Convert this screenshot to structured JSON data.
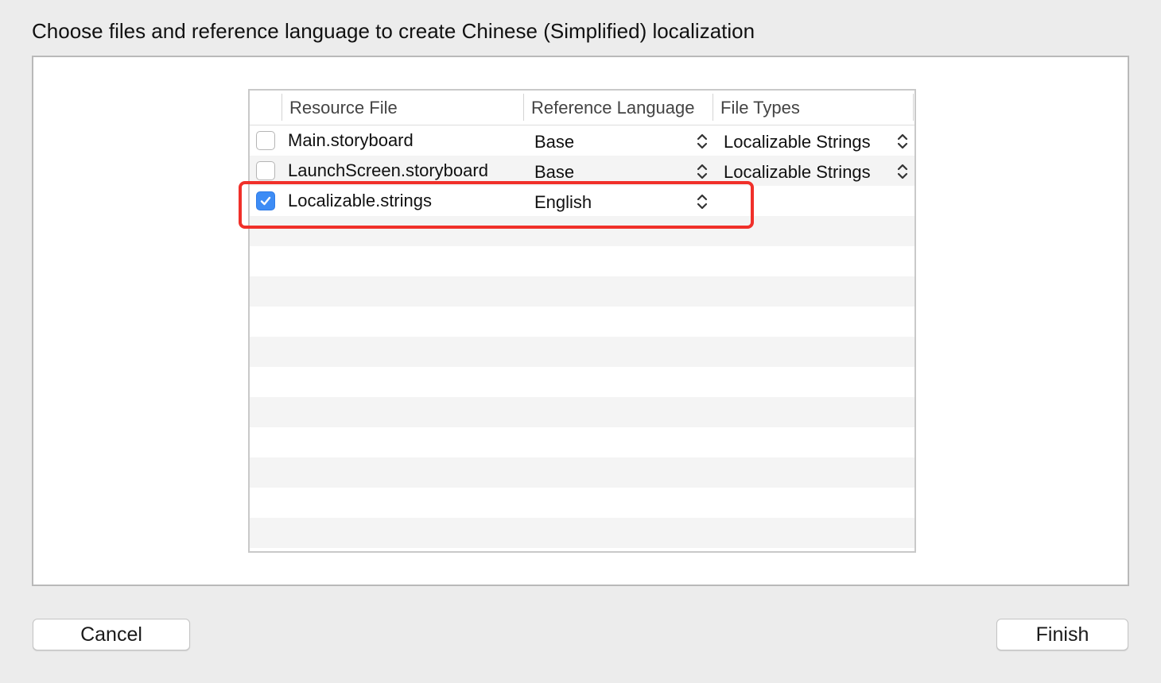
{
  "dialog": {
    "prompt": "Choose files and reference language to create Chinese (Simplified) localization"
  },
  "table": {
    "columns": {
      "resource_file": "Resource File",
      "reference_language": "Reference Language",
      "file_types": "File Types"
    },
    "rows": [
      {
        "checked": false,
        "file": "Main.storyboard",
        "language": "Base",
        "type": "Localizable Strings"
      },
      {
        "checked": false,
        "file": "LaunchScreen.storyboard",
        "language": "Base",
        "type": "Localizable Strings"
      },
      {
        "checked": true,
        "file": "Localizable.strings",
        "language": "English",
        "type": ""
      }
    ]
  },
  "buttons": {
    "cancel": "Cancel",
    "finish": "Finish"
  },
  "colors": {
    "checkbox_checked": "#3d8cf5",
    "highlight_annotation": "#f0302a",
    "row_alternate": "#f4f4f4"
  },
  "icons": [
    "checkmark-icon",
    "up-down-chevron-icon"
  ]
}
